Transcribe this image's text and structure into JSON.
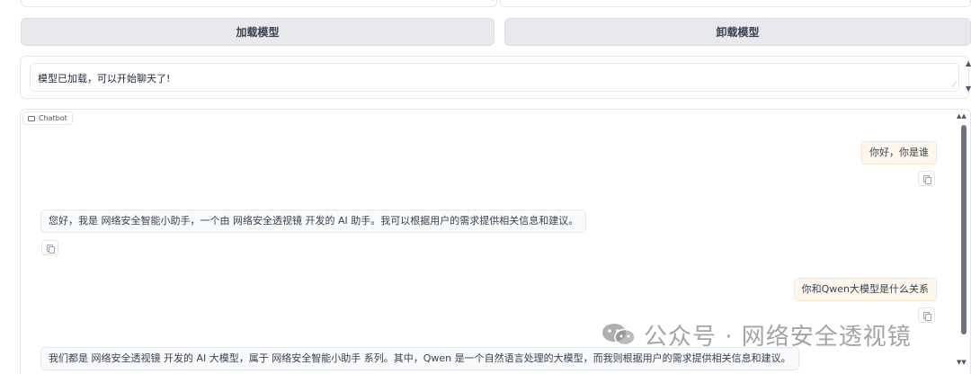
{
  "buttons": {
    "load_model": "加载模型",
    "unload_model": "卸载模型"
  },
  "status": {
    "message": "模型已加载，可以开始聊天了!"
  },
  "chatbot": {
    "label": "Chatbot",
    "messages": [
      {
        "role": "user",
        "text": "你好，你是谁"
      },
      {
        "role": "assistant",
        "text": "您好，我是 网络安全智能小助手，一个由 网络安全透视镜 开发的 AI 助手。我可以根据用户的需求提供相关信息和建议。"
      },
      {
        "role": "user",
        "text": "你和Qwen大模型是什么关系"
      },
      {
        "role": "assistant",
        "text": "我们都是 网络安全透视镜 开发的 AI 大模型，属于 网络安全智能小助手 系列。其中，Qwen 是一个自然语言处理的大模型，而我则根据用户的需求提供相关信息和建议。"
      }
    ]
  },
  "watermark": {
    "text": "公众号 · 网络安全透视镜"
  },
  "icons": {
    "copy": "copy-icon",
    "chat": "chat-bubble-icon",
    "wechat": "wechat-icon"
  },
  "colors": {
    "user_bubble": "#fff7ed",
    "bot_bubble": "#f9fafb",
    "button_bg": "#e8e9ec"
  }
}
